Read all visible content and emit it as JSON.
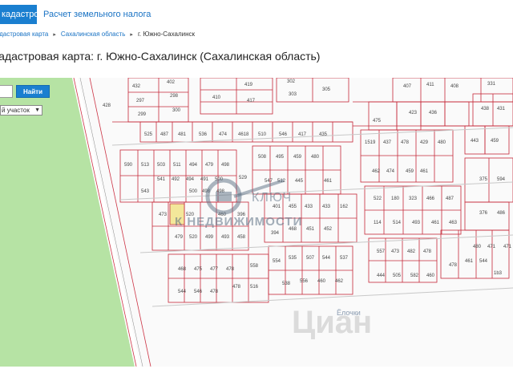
{
  "nav": {
    "active_tab": "кадастровая карта",
    "tax_link": "Расчет земельного налога"
  },
  "breadcrumb": {
    "item1": "Кадастровая карта",
    "item2": "Сахалинская область",
    "item3": "г. Южно-Сахалинск"
  },
  "title": "Кадастровая карта: г. Южно-Сахалинск (Сахалинская область)",
  "search": {
    "button": "Найти",
    "select_value": "й участок"
  },
  "watermark": {
    "line1": "КЛЮЧ",
    "line2": "К НЕДВИЖИМОСТИ",
    "cian": "Циан"
  },
  "map": {
    "area_label": "Ёлочки"
  },
  "parcels_row1": [
    "432",
    "402",
    "410",
    "419",
    "417",
    "302",
    "303",
    "305",
    "407",
    "411",
    "408",
    "331",
    "297",
    "298",
    "299",
    "300",
    "428",
    "423",
    "436",
    "438",
    "431"
  ],
  "parcels_row2": [
    "525",
    "487",
    "481",
    "536",
    "474",
    "4618",
    "510",
    "546",
    "417",
    "435",
    "475",
    "443",
    "459",
    "487"
  ],
  "parcels_row3": [
    "513",
    "503",
    "511",
    "494",
    "479",
    "498",
    "535",
    "503",
    "1519",
    "437",
    "478",
    "429",
    "480",
    "594"
  ],
  "parcels_row4": [
    "541",
    "492",
    "494",
    "491",
    "500",
    "498",
    "529",
    "512",
    "547",
    "445",
    "459",
    "461",
    "462",
    "375"
  ],
  "parcels_row5": [
    "473",
    "520",
    "460",
    "396",
    "401",
    "455",
    "433",
    "162",
    "522",
    "180",
    "323",
    "466",
    "487",
    "376"
  ],
  "parcels_row6": [
    "470",
    "499",
    "493",
    "458",
    "468",
    "394",
    "451",
    "452",
    "514",
    "493",
    "461",
    "463",
    "480"
  ],
  "parcels_row7": [
    "468",
    "475",
    "477",
    "478",
    "515",
    "535",
    "545",
    "544",
    "537",
    "473",
    "482",
    "478",
    "461"
  ],
  "parcels_row8": [
    "544",
    "546",
    "558",
    "516",
    "538",
    "556",
    "460",
    "462",
    "444",
    "505",
    "582",
    "460"
  ]
}
